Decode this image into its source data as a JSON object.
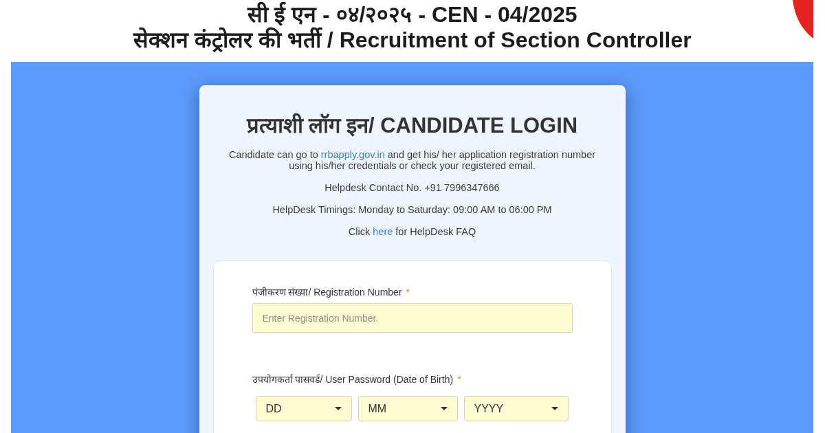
{
  "header": {
    "line_1": "सी ई एन - ०४/२०२५ - CEN - 04/2025",
    "title": "सेक्शन कंट्रोलर की भर्ती / Recruitment of Section Controller"
  },
  "login_card": {
    "title": "प्रत्याशी लॉग इन/ CANDIDATE LOGIN",
    "info_lines": [
      {
        "kind": "link_text",
        "before": "Candidate can go to",
        "link": "rrbapply.gov.in",
        "after": "and get his/ her application registration number using his/her credentials or check your registered email."
      },
      {
        "kind": "text",
        "text": "Helpdesk Contact No. +91 7996347666"
      },
      {
        "kind": "text",
        "text": "HelpDesk Timings: Monday to Saturday: 09:00 AM to 06:00 PM"
      },
      {
        "kind": "link_text",
        "before": "Click",
        "link": "here",
        "after": "for HelpDesk FAQ"
      }
    ],
    "form": {
      "fields": [
        {
          "kind": "text",
          "label": "पंजीकरण संख्या/ Registration Number",
          "required_mark": "*",
          "placeholder": "Enter Registration Number."
        },
        {
          "kind": "date",
          "label": "उपयोगकर्ता पासवर्ड/ User Password (Date of Birth)",
          "required_mark": "*",
          "selects": [
            {
              "value": "DD"
            },
            {
              "value": "MM"
            },
            {
              "value": "YYYY"
            }
          ]
        }
      ]
    }
  }
}
